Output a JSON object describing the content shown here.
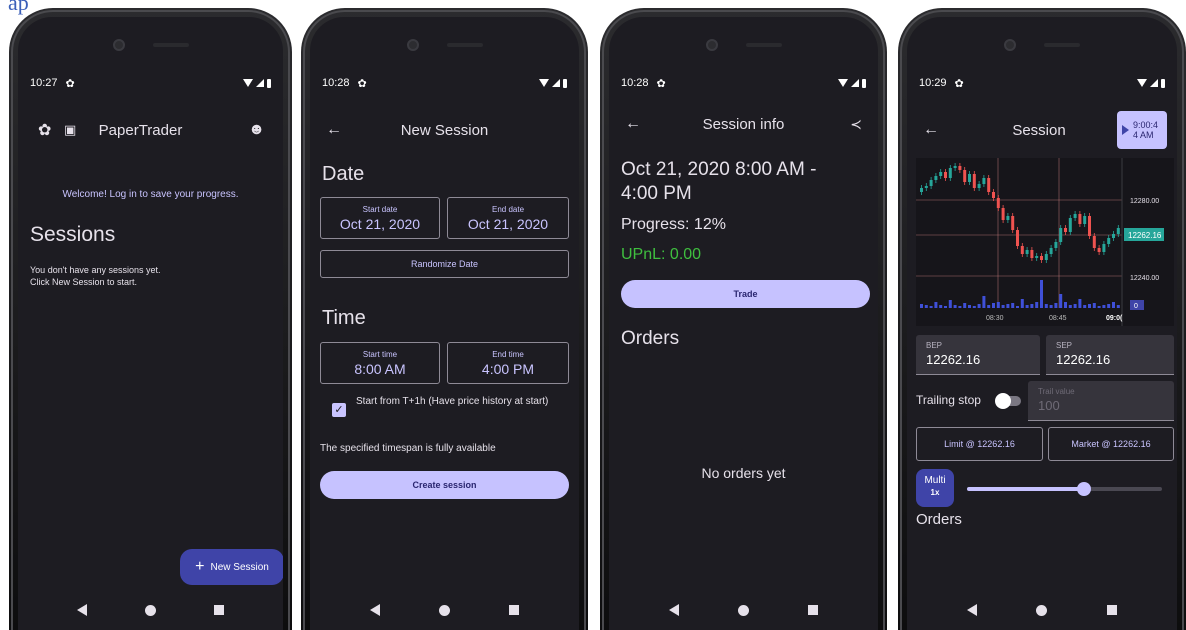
{
  "phones": [
    {
      "status_time": "10:27",
      "title": "PaperTrader",
      "welcome": "Welcome! Log in to save your progress.",
      "heading": "Sessions",
      "empty_line1": "You don't have any sessions yet.",
      "empty_line2": "Click New Session to start.",
      "fab_label": "New Session"
    },
    {
      "status_time": "10:28",
      "title": "New Session",
      "date_heading": "Date",
      "start_date_label": "Start date",
      "start_date": "Oct 21, 2020",
      "end_date_label": "End date",
      "end_date": "Oct 21, 2020",
      "randomize_label": "Randomize Date",
      "time_heading": "Time",
      "start_time_label": "Start time",
      "start_time": "8:00 AM",
      "end_time_label": "End time",
      "end_time": "4:00 PM",
      "checkbox_label": "Start from T+1h (Have price history at start)",
      "availability": "The specified timespan is fully available",
      "create_label": "Create session"
    },
    {
      "status_time": "10:28",
      "title": "Session info",
      "range_line1": "Oct 21, 2020 8:00 AM -",
      "range_line2": "4:00 PM",
      "progress": "Progress: 12%",
      "upnl": "UPnL: 0.00",
      "trade_label": "Trade",
      "orders_heading": "Orders",
      "no_orders": "No orders yet"
    },
    {
      "status_time": "10:29",
      "title": "Session",
      "time_btn_line1": "9:00:4",
      "time_btn_line2": "4 AM",
      "chart": {
        "price_labels": [
          "12280.00",
          "12262.16",
          "12240.00"
        ],
        "time_labels": [
          "08:30",
          "08:45",
          "09:0("
        ],
        "current_price": "12262.16",
        "volume_tag": "0"
      },
      "bep_label": "BEP",
      "bep_value": "12262.16",
      "sep_label": "SEP",
      "sep_value": "12262.16",
      "trailing_label": "Trailing stop",
      "trail_value_label": "Trail value",
      "trail_value": "100",
      "limit_label": "Limit @ 12262.16",
      "market_label": "Market @ 12262.16",
      "multi_label": "Multi",
      "multi_value": "1x",
      "orders_heading": "Orders"
    }
  ],
  "colors": {
    "bg": "#1d1c22",
    "accent": "#c6c2ff",
    "fab": "#3f44a8",
    "up": "#26a69a",
    "down": "#ef5350",
    "profit": "#3fbf3f"
  },
  "top_fragment": "ap"
}
